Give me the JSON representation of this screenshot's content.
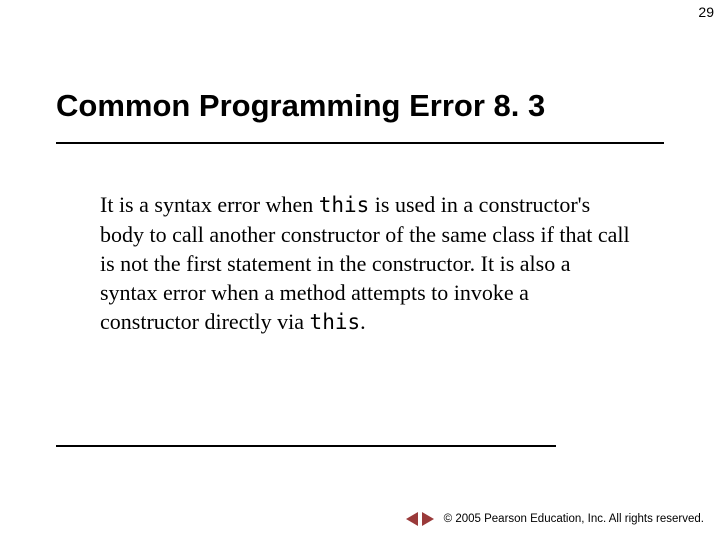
{
  "page_number": "29",
  "title": "Common Programming Error 8. 3",
  "body": {
    "p1a": "It is a syntax error when ",
    "p1_code1": "this",
    "p1b": " is used in a constructor's body to call another constructor of the same class if that call is not the first statement in the constructor. It is also a syntax error when a method attempts to invoke a constructor directly via ",
    "p1_code2": "this",
    "p1c": "."
  },
  "footer": {
    "copyright": "© 2005 Pearson Education, Inc.  All rights reserved."
  }
}
